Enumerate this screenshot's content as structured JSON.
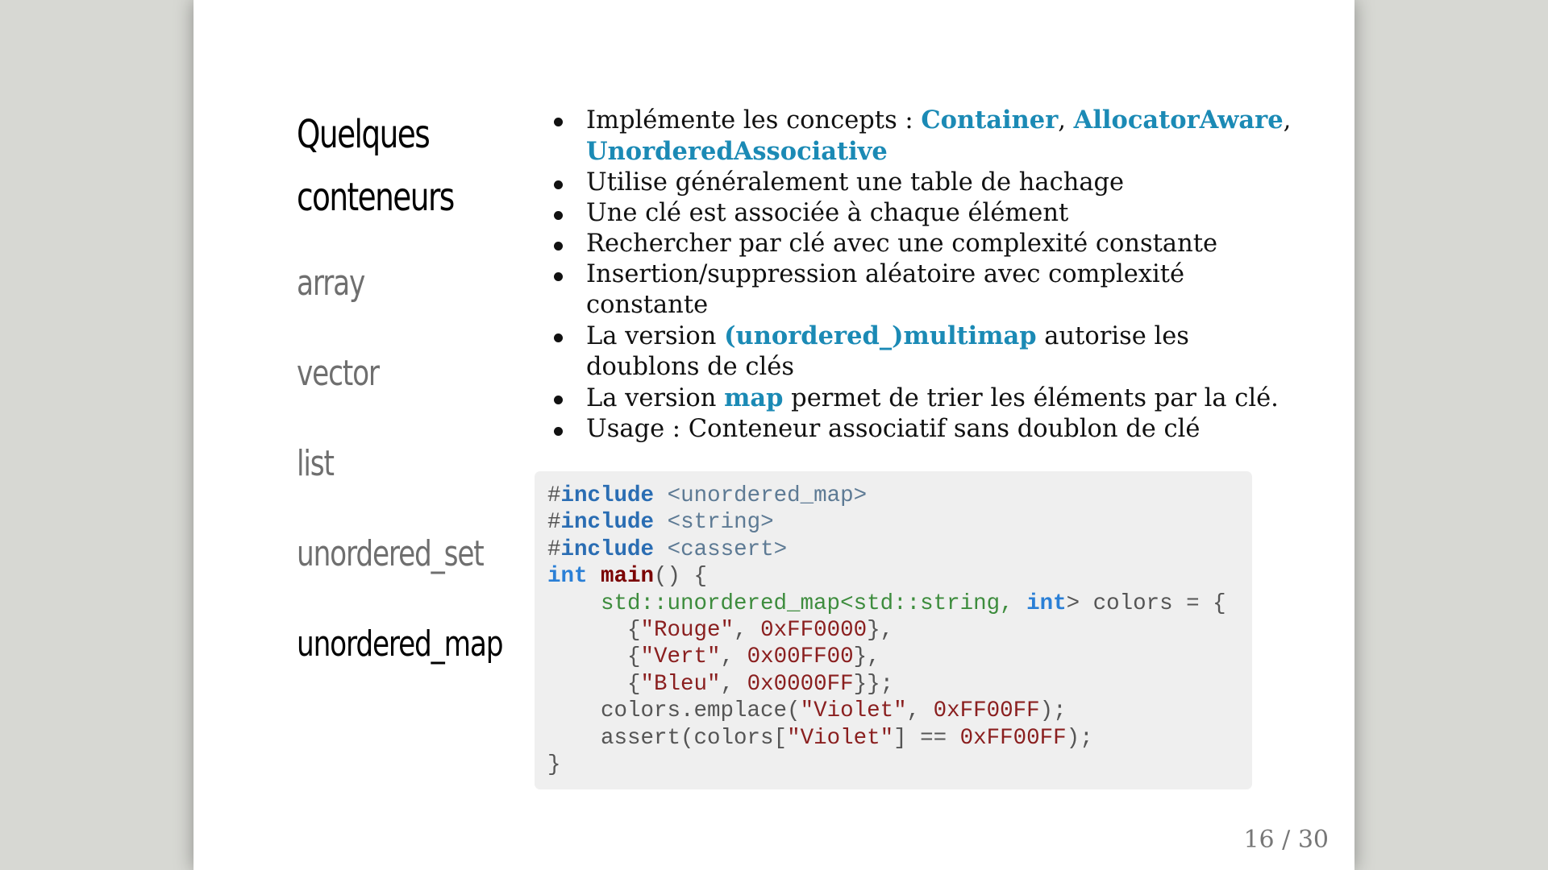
{
  "sidebar": {
    "title_line1": "Quelques",
    "title_line2": "conteneurs",
    "items": [
      {
        "label": "array",
        "active": false
      },
      {
        "label": "vector",
        "active": false
      },
      {
        "label": "list",
        "active": false
      },
      {
        "label": "unordered_set",
        "active": false
      },
      {
        "label": "unordered_map",
        "active": true
      }
    ]
  },
  "content": {
    "bullet1": {
      "text": "Implémente les concepts : ",
      "link1": "Container",
      "sep1": ", ",
      "link2": "AllocatorAware",
      "sep2": ",",
      "link3": "UnorderedAssociative"
    },
    "bullet2": "Utilise généralement une table de hachage",
    "bullet3": "Une clé est associée à chaque élément",
    "bullet4": "Rechercher par clé avec une complexité constante",
    "bullet5": {
      "line1": "Insertion/suppression aléatoire avec complexité",
      "line2": "constante"
    },
    "bullet6": {
      "before": "La version ",
      "link": "(unordered_)multimap",
      "after": " autorise les",
      "line2": "doublons de clés"
    },
    "bullet7": {
      "before": "La version ",
      "link": "map",
      "after": " permet de trier les éléments par la clé."
    },
    "bullet8": "Usage : Conteneur associatif sans doublon de clé"
  },
  "code": {
    "hash": "#",
    "include_kw": "include",
    "h1": "<unordered_map>",
    "h2": "<string>",
    "h3": "<cassert>",
    "int_kw": "int",
    "main_fn": "main",
    "main_rest": "() {",
    "indent": "    ",
    "ns1": "std::unordered_map<std::string, ",
    "map_rest": "> colors = {",
    "row1_open": "      {",
    "row1_str": "\"Rouge\"",
    "row1_sep": ", ",
    "row1_num": "0xFF0000",
    "row1_close": "},",
    "row2_str": "\"Vert\"",
    "row2_num": "0x00FF00",
    "row3_str": "\"Bleu\"",
    "row3_num": "0x0000FF",
    "row3_close": "}};",
    "emplace_pre": "    colors.emplace(",
    "emplace_str": "\"Violet\"",
    "emplace_num": "0xFF00FF",
    "emplace_close": ");",
    "assert_pre": "    assert(colors[",
    "assert_mid": "] == ",
    "close_brace": "}"
  },
  "page_number": "16 / 30"
}
